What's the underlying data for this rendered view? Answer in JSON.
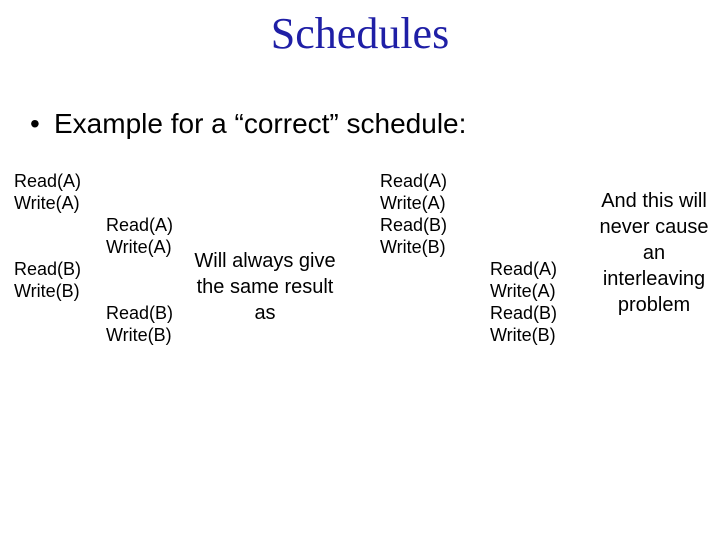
{
  "title": "Schedules",
  "bullet": "Example for a “correct” schedule:",
  "left_block": {
    "t1": {
      "op1": "Read(A)",
      "op2": "Write(A)",
      "op3": "Read(B)",
      "op4": "Write(B)"
    },
    "t2": {
      "op1": "Read(A)",
      "op2": "Write(A)",
      "op3": "Read(B)",
      "op4": "Write(B)"
    }
  },
  "mid_caption": "Will always\ngive the same\nresult as",
  "right_block": {
    "t1": {
      "op1": "Read(A)",
      "op2": "Write(A)",
      "op3": "Read(B)",
      "op4": "Write(B)"
    },
    "t2": {
      "op1": "Read(A)",
      "op2": "Write(A)",
      "op3": "Read(B)",
      "op4": "Write(B)"
    }
  },
  "right_caption": "And this\nwill never\ncause an\ninterleaving\nproblem"
}
